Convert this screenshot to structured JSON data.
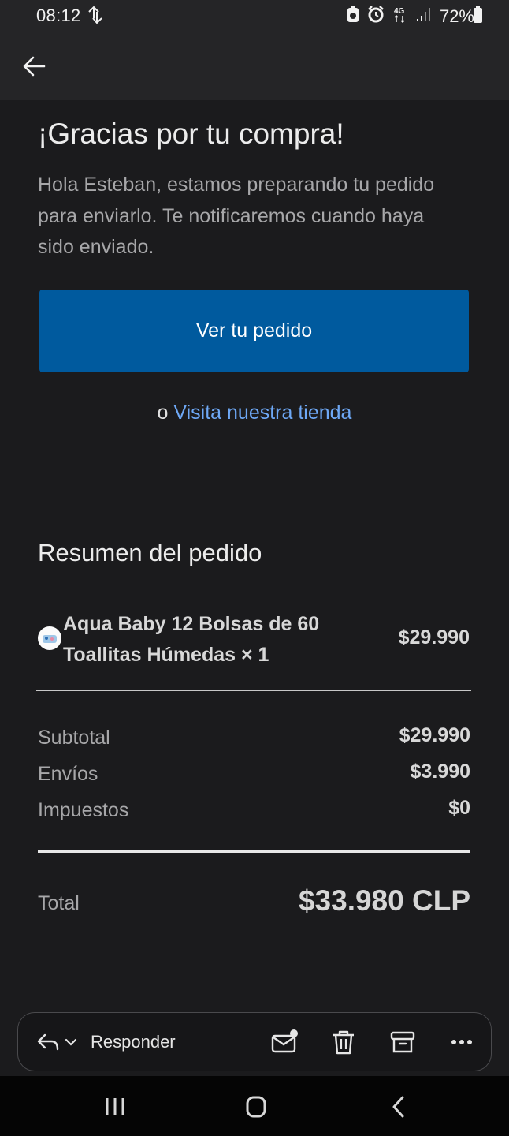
{
  "status_bar": {
    "time": "08:12",
    "network": "4G",
    "battery": "72%",
    "icons": [
      "data-transfer-icon",
      "clipboard-icon",
      "alarm-icon",
      "network-4g-icon",
      "signal-icon",
      "battery-icon"
    ]
  },
  "app_bar": {
    "back_icon": "arrow-left-icon"
  },
  "email": {
    "title": "¡Gracias por tu compra!",
    "intro": "Hola Esteban, estamos preparando tu pedido para enviarlo. Te notificaremos cuando haya sido enviado.",
    "cta_label": "Ver tu pedido",
    "alt_prefix": "o",
    "alt_link": "Visita nuestra tienda",
    "summary_title": "Resumen del pedido",
    "product": {
      "name": "Aqua Baby 12 Bolsas de 60 Toallitas Húmedas × 1",
      "price": "$29.990"
    },
    "subtotal_label": "Subtotal",
    "subtotal_value": "$29.990",
    "shipping_label": "Envíos",
    "shipping_value": "$3.990",
    "taxes_label": "Impuestos",
    "taxes_value": "$0",
    "total_label": "Total",
    "total_value": "$33.980 CLP"
  },
  "actions": {
    "reply_label": "Responder",
    "icons": [
      "reply-icon",
      "chevron-down-icon",
      "mark-unread-icon",
      "delete-icon",
      "archive-icon",
      "more-icon"
    ]
  },
  "colors": {
    "cta": "#005a9e",
    "link": "#6ea8f5",
    "background": "#1b1b1d"
  }
}
